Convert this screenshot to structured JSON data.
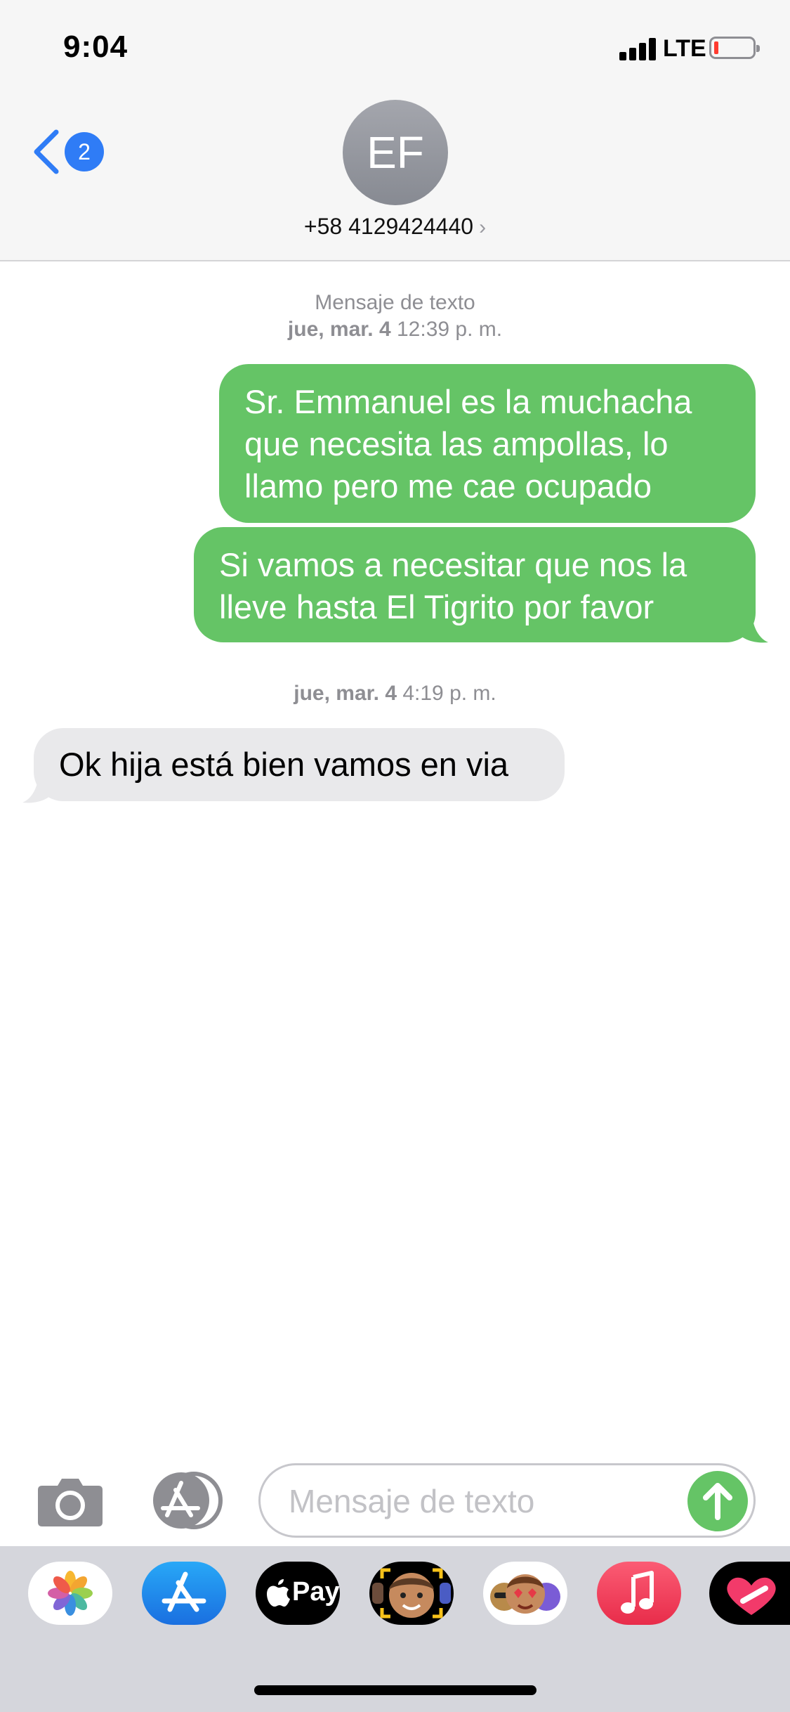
{
  "status_bar": {
    "time": "9:04",
    "network": "LTE"
  },
  "header": {
    "back_badge": "2",
    "avatar_initials": "EF",
    "contact_name": "+58 4129424440",
    "chevron": "›"
  },
  "conversation": {
    "header_label": "Mensaje de texto",
    "header_date_bold": "jue, mar. 4",
    "header_time": "12:39 p. m.",
    "messages_sent": [
      {
        "lines": [
          "Sr. Emmanuel es la muchacha",
          "que necesita las ampollas, lo",
          "llamo pero me cae ocupado"
        ]
      },
      {
        "lines": [
          "Si vamos a necesitar que nos la",
          "lleve hasta El Tigrito por favor"
        ]
      }
    ],
    "second_date_bold": "jue, mar. 4",
    "second_time": "4:19 p. m.",
    "message_received": "Ok hija está bien vamos en via"
  },
  "composer": {
    "placeholder": "Mensaje de texto"
  },
  "app_drawer": {
    "apps": [
      "photos-icon",
      "app-store-icon",
      "apple-pay-icon",
      "memoji-icon",
      "animoji-stickers-icon",
      "music-icon",
      "digital-touch-icon"
    ],
    "apple_pay_label": "Pay"
  },
  "colors": {
    "sent_bubble": "#65c466",
    "received_bubble": "#e9e9eb",
    "accent_blue": "#2f7cf6"
  }
}
